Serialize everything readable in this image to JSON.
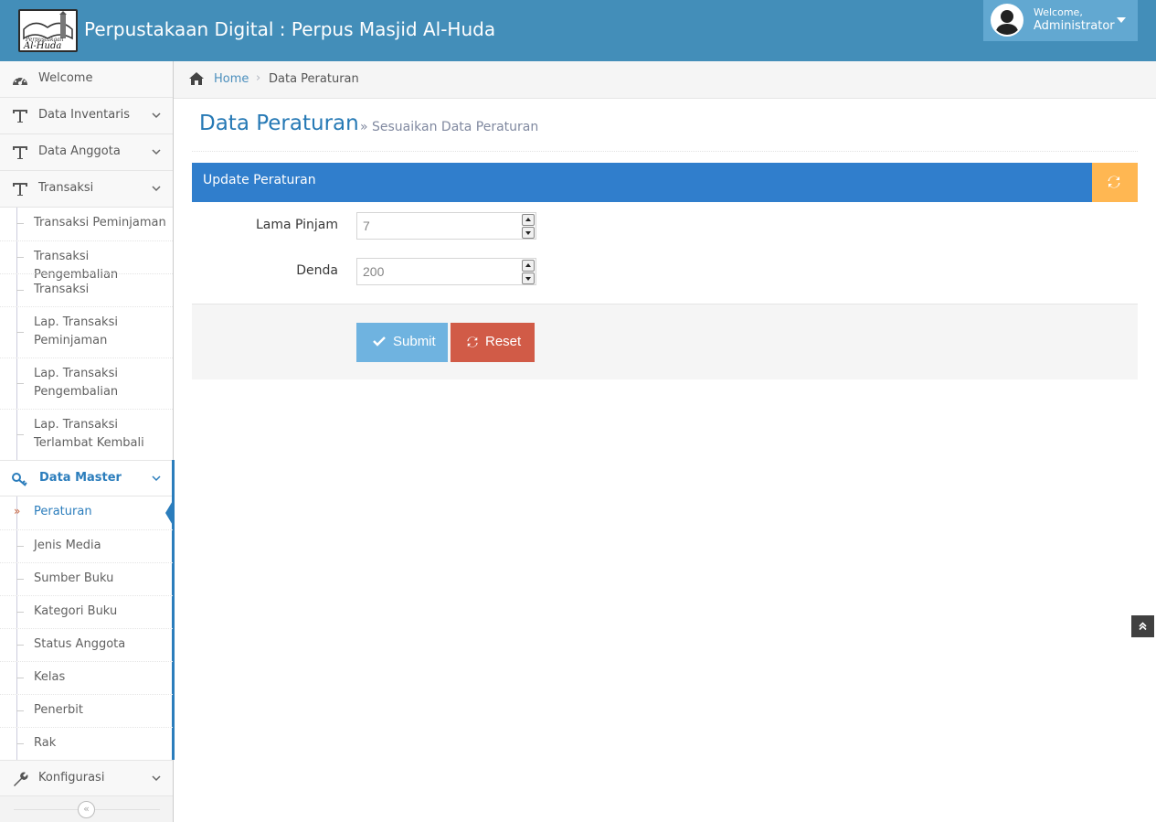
{
  "header": {
    "logo_text": "Perpustakaan Al-Huda",
    "brand": "Perpustakaan Digital : Perpus Masjid Al-Huda",
    "welcome_small": "Welcome,",
    "user_name": "Administrator"
  },
  "sidebar": {
    "items": [
      {
        "label": "Welcome",
        "icon": "dashboard-icon"
      },
      {
        "label": "Data Inventaris",
        "icon": "text-icon"
      },
      {
        "label": "Data Anggota",
        "icon": "text-icon"
      },
      {
        "label": "Transaksi",
        "icon": "text-icon"
      }
    ],
    "transaksi_sub": [
      {
        "label": "Transaksi Peminjaman"
      },
      {
        "label": "Transaksi Pengembalian"
      },
      {
        "label": "Transaksi"
      },
      {
        "label": "Lap. Transaksi Peminjaman"
      },
      {
        "label": "Lap. Transaksi Pengembalian"
      },
      {
        "label": "Lap. Transaksi Terlambat Kembali"
      }
    ],
    "data_master": {
      "label": "Data Master",
      "icon": "key-icon"
    },
    "master_sub": [
      {
        "label": "Peraturan"
      },
      {
        "label": "Jenis Media"
      },
      {
        "label": "Sumber Buku"
      },
      {
        "label": "Kategori Buku"
      },
      {
        "label": "Status Anggota"
      },
      {
        "label": "Kelas"
      },
      {
        "label": "Penerbit"
      },
      {
        "label": "Rak"
      }
    ],
    "konfigurasi": {
      "label": "Konfigurasi",
      "icon": "wrench-icon"
    },
    "collapse_glyph": "«"
  },
  "breadcrumb": {
    "home": "Home",
    "separator": "›",
    "current": "Data Peraturan"
  },
  "page": {
    "title": "Data Peraturan",
    "subtitle": "» Sesuaikan Data Peraturan"
  },
  "widget": {
    "title": "Update Peraturan"
  },
  "form": {
    "lama_pinjam_label": "Lama Pinjam",
    "lama_pinjam_value": "7",
    "denda_label": "Denda",
    "denda_value": "200",
    "submit_label": "Submit",
    "reset_label": "Reset"
  },
  "colors": {
    "navbar": "#438eb9",
    "widget_header": "#307ecc",
    "submit": "#6fb3e0",
    "reset": "#d15b47",
    "reload": "#ffb752"
  }
}
